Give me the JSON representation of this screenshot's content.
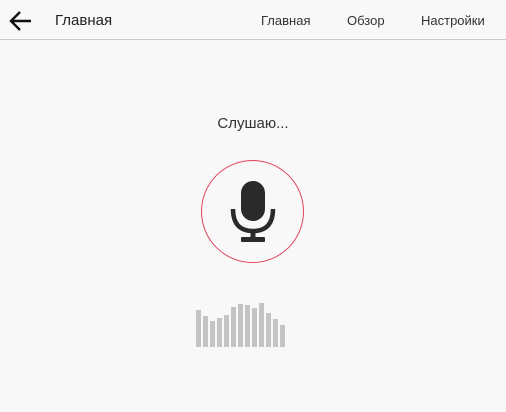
{
  "header": {
    "back_icon": "arrow-left-icon",
    "title": "Главная",
    "nav": [
      {
        "label": "Главная"
      },
      {
        "label": "Обзор"
      },
      {
        "label": "Настройки"
      }
    ]
  },
  "main": {
    "status": "Слушаю...",
    "mic_icon": "microphone-icon",
    "accent_color": "#e0445c",
    "waveform_levels": [
      0.77,
      0.64,
      0.55,
      0.61,
      0.66,
      0.84,
      0.9,
      0.88,
      0.82,
      0.91,
      0.7,
      0.59,
      0.45
    ]
  }
}
